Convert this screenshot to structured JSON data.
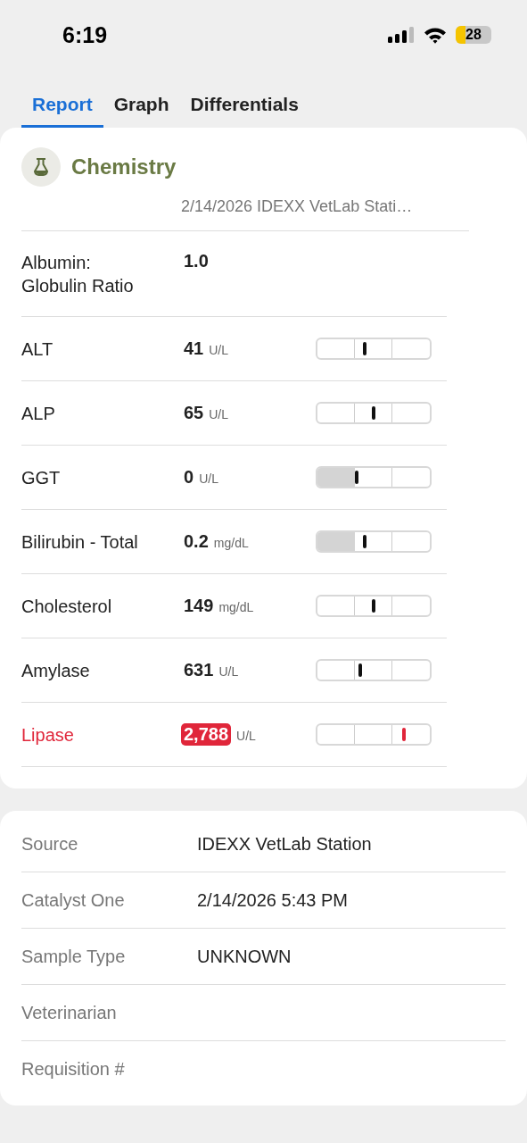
{
  "status_bar": {
    "time": "6:19",
    "battery": "28"
  },
  "tabs": [
    {
      "label": "Report",
      "selected": true
    },
    {
      "label": "Graph",
      "selected": false
    },
    {
      "label": "Differentials",
      "selected": false
    }
  ],
  "chemistry": {
    "title": "Chemistry",
    "source_line": "2/14/2026 IDEXX VetLab Stati…",
    "rows": [
      {
        "name": "Albumin: Globulin Ratio",
        "value": "1.0",
        "kind": "plain"
      },
      {
        "name": "ALT",
        "value": "41",
        "unit": "U/L",
        "kind": "gauge",
        "level": 0.42,
        "low_shaded": false,
        "flagged": false
      },
      {
        "name": "ALP",
        "value": "65",
        "unit": "U/L",
        "kind": "gauge",
        "level": 0.5,
        "low_shaded": false,
        "flagged": false
      },
      {
        "name": "GGT",
        "value": "0",
        "unit": "U/L",
        "kind": "gauge",
        "level": 0.35,
        "low_shaded": true,
        "flagged": false
      },
      {
        "name": "Bilirubin - Total",
        "value": "0.2",
        "unit": "mg/dL",
        "kind": "gauge",
        "level": 0.42,
        "low_shaded": true,
        "flagged": false
      },
      {
        "name": "Cholesterol",
        "value": "149",
        "unit": "mg/dL",
        "kind": "gauge",
        "level": 0.5,
        "low_shaded": false,
        "flagged": false
      },
      {
        "name": "Amylase",
        "value": "631",
        "unit": "U/L",
        "kind": "gauge",
        "level": 0.38,
        "low_shaded": false,
        "flagged": false
      },
      {
        "name": "Lipase",
        "value": "2,788",
        "unit": "U/L",
        "kind": "gauge",
        "level": 0.77,
        "low_shaded": false,
        "flagged": true
      }
    ]
  },
  "details": [
    {
      "label": "Source",
      "value": "IDEXX VetLab Station"
    },
    {
      "label": "Catalyst One",
      "value": "2/14/2026 5:43 PM"
    },
    {
      "label": "Sample Type",
      "value": "UNKNOWN"
    },
    {
      "label": "Veterinarian"
    },
    {
      "label": "Requisition #"
    }
  ]
}
